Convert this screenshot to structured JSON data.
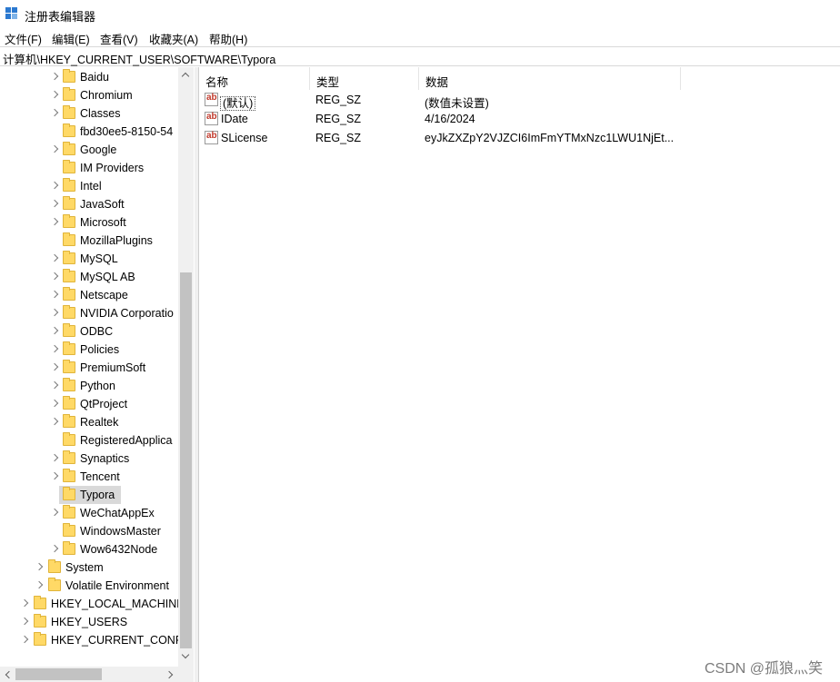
{
  "window": {
    "title": "注册表编辑器"
  },
  "menu": [
    "文件(F)",
    "编辑(E)",
    "查看(V)",
    "收藏夹(A)",
    "帮助(H)"
  ],
  "address": "计算机\\HKEY_CURRENT_USER\\SOFTWARE\\Typora",
  "tree": {
    "software_children": [
      "Baidu",
      "Chromium",
      "Classes",
      "fbd30ee5-8150-54",
      "Google",
      "IM Providers",
      "Intel",
      "JavaSoft",
      "Microsoft",
      "MozillaPlugins",
      "MySQL",
      "MySQL AB",
      "Netscape",
      "NVIDIA Corporatio",
      "ODBC",
      "Policies",
      "PremiumSoft",
      "Python",
      "QtProject",
      "Realtek",
      "RegisteredApplica",
      "Synaptics",
      "Tencent",
      "Typora",
      "WeChatAppEx",
      "WindowsMaster",
      "Wow6432Node"
    ],
    "hkcu_children": [
      "System",
      "Volatile Environment"
    ],
    "roots": [
      "HKEY_LOCAL_MACHINE",
      "HKEY_USERS",
      "HKEY_CURRENT_CONFIG"
    ],
    "selected": "Typora"
  },
  "list": {
    "columns": [
      "名称",
      "类型",
      "数据"
    ],
    "rows": [
      {
        "name": "(默认)",
        "type": "REG_SZ",
        "data": "(数值未设置)"
      },
      {
        "name": "IDate",
        "type": "REG_SZ",
        "data": "4/16/2024"
      },
      {
        "name": "SLicense",
        "type": "REG_SZ",
        "data": "eyJkZXZpY2VJZCI6ImFmYTMxNzc1LWU1NjEt..."
      }
    ]
  },
  "icons": {
    "app": "registry-editor-icon",
    "value": "string-value-icon",
    "folder": "folder-icon"
  },
  "watermark": "CSDN @孤狼灬笑"
}
